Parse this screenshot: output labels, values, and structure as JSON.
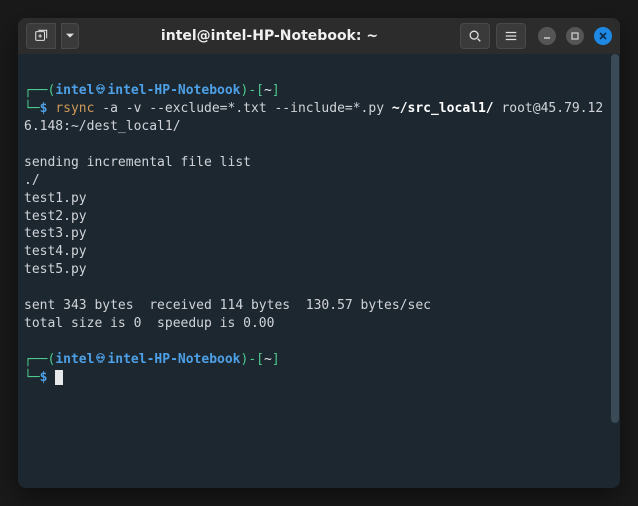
{
  "window": {
    "title": "intel@intel-HP-Notebook: ~"
  },
  "prompt": {
    "open1": "┌──(",
    "user": "intel",
    "at": "㉿",
    "host": "intel-HP-Notebook",
    "close1": ")-[",
    "path": "~",
    "close2": "]",
    "line2_prefix": "└─",
    "dollar": "$"
  },
  "command": {
    "cmd": "rsync",
    "flags": " -a -v --exclude=*.txt --include=*.py ",
    "src": "~/src_local1/",
    "rest": " root@45.79.126.148:~/dest_local1/"
  },
  "output": {
    "l1": "sending incremental file list",
    "l2": "./",
    "l3": "test1.py",
    "l4": "test2.py",
    "l5": "test3.py",
    "l6": "test4.py",
    "l7": "test5.py",
    "l8": "",
    "l9": "sent 343 bytes  received 114 bytes  130.57 bytes/sec",
    "l10": "total size is 0  speedup is 0.00"
  }
}
